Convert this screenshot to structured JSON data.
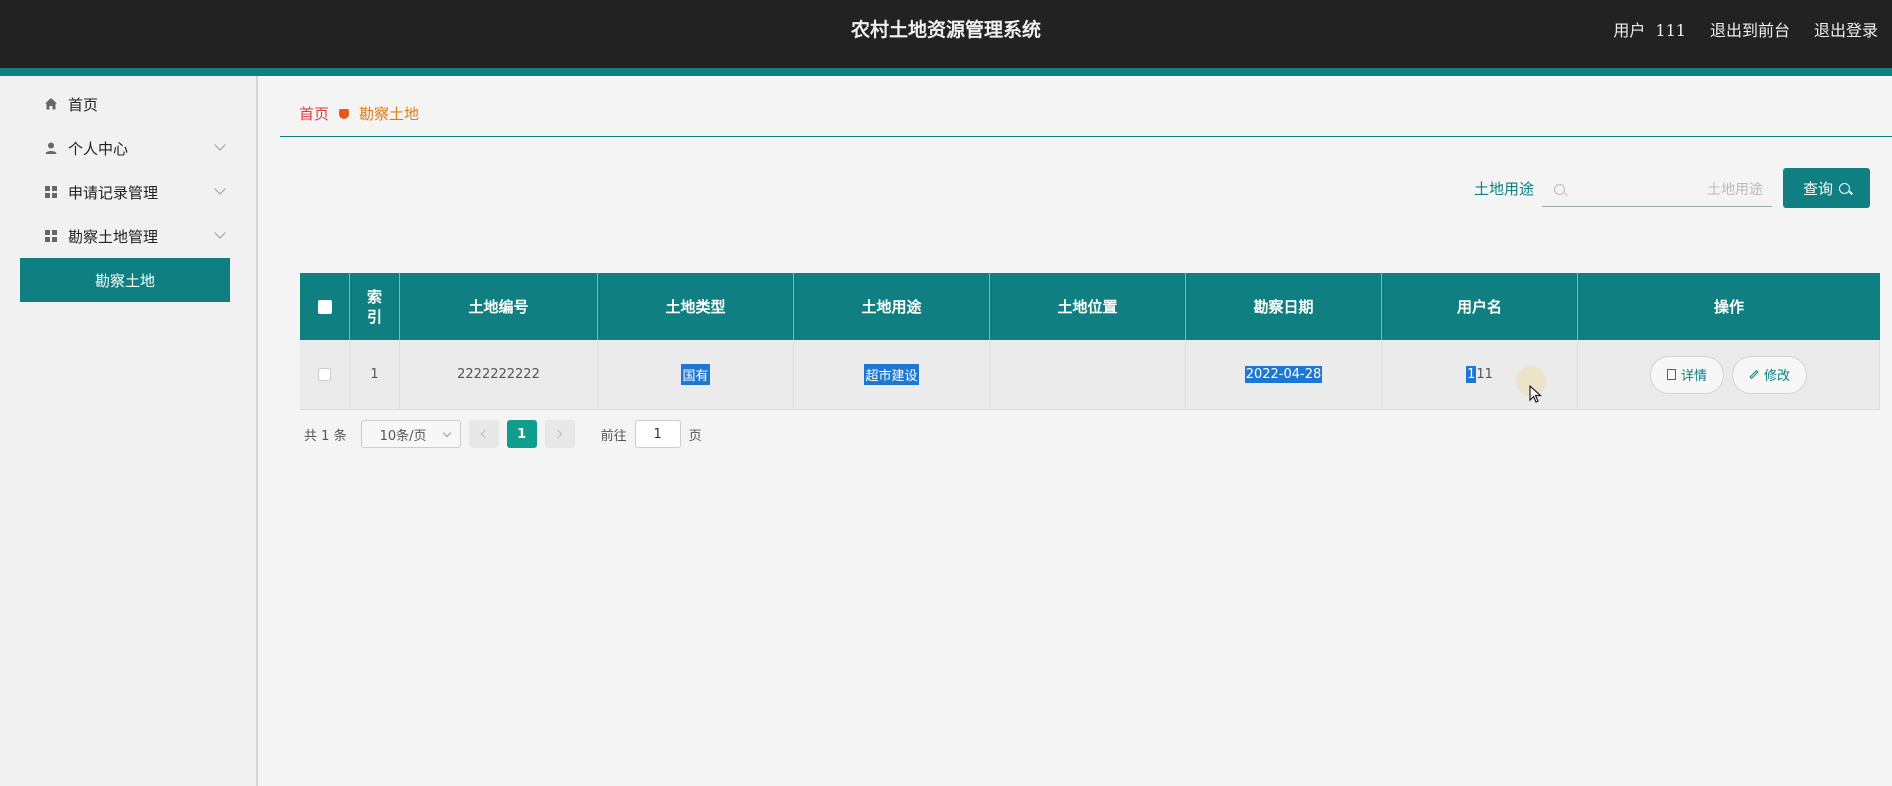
{
  "header": {
    "title": "农村土地资源管理系统",
    "user_label": "用户",
    "user_id": "111",
    "to_front": "退出到前台",
    "logout": "退出登录"
  },
  "sidebar": {
    "items": [
      {
        "label": "首页",
        "icon": "home-icon"
      },
      {
        "label": "个人中心",
        "icon": "user-icon"
      },
      {
        "label": "申请记录管理",
        "icon": "grid-icon"
      },
      {
        "label": "勘察土地管理",
        "icon": "grid-icon"
      }
    ],
    "active_sub": "勘察土地"
  },
  "breadcrumb": {
    "home": "首页",
    "current": "勘察土地"
  },
  "search": {
    "label": "土地用途",
    "placeholder": "土地用途",
    "button": "查询"
  },
  "table": {
    "headers": [
      "索引",
      "土地编号",
      "土地类型",
      "土地用途",
      "土地位置",
      "勘察日期",
      "用户名",
      "操作"
    ],
    "index_header": [
      "索",
      "引"
    ],
    "rows": [
      {
        "index": "1",
        "land_no": "2222222222",
        "land_type": "国有",
        "land_use": "超市建设",
        "land_location": "",
        "survey_date": "2022-04-28",
        "username_sel": "1",
        "username_rest": "11",
        "detail": "详情",
        "edit": "修改"
      }
    ]
  },
  "pagination": {
    "total_prefix": "共",
    "total": "1",
    "total_suffix": "条",
    "page_size": "10条/页",
    "current_page": "1",
    "goto_label": "前往",
    "goto_value": "1",
    "page_unit": "页"
  },
  "colors": {
    "primary": "#0f7f81",
    "header_bg": "#222222",
    "selection": "#1e78d2"
  }
}
